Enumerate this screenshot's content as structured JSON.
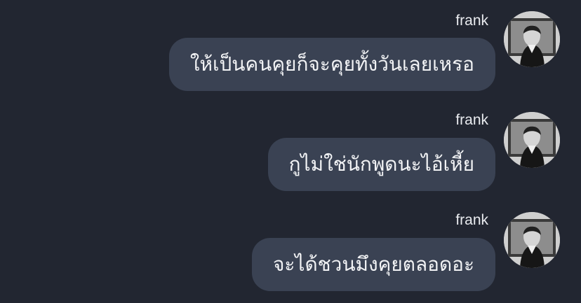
{
  "messages": [
    {
      "sender": "frank",
      "text": "ให้เป็นคนคุยก็จะคุยทั้งวันเลยเหรอ"
    },
    {
      "sender": "frank",
      "text": "กูไม่ใช่นักพูดนะไอ้เหี้ย"
    },
    {
      "sender": "frank",
      "text": "จะได้ชวนมึงคุยตลอดอะ"
    }
  ]
}
